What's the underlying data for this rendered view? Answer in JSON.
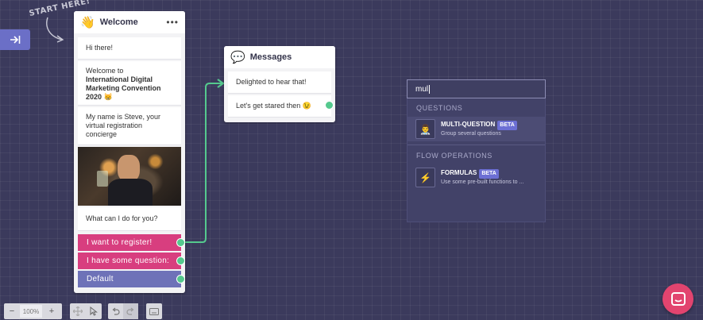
{
  "canvas": {
    "start_hint": "START HERE!"
  },
  "welcome_node": {
    "emoji": "👋",
    "title": "Welcome",
    "menu": "•••",
    "messages": [
      "Hi there!",
      "Welcome to",
      "International Digital Marketing Convention 2020 😸",
      "My name is Steve, your virtual registration concierge",
      "What can I do for you?"
    ],
    "options": [
      "I want to register!",
      "I have some question:",
      "Default"
    ]
  },
  "messages_node": {
    "emoji": "💬",
    "title": "Messages",
    "messages": [
      "Delighted to hear that!",
      "Let's get stared then 😉"
    ]
  },
  "search": {
    "value": "mul",
    "sections": [
      {
        "heading": "QUESTIONS",
        "results": [
          {
            "icon": "👨‍⚕️",
            "label": "MULTI-QUESTION",
            "badge": "BETA",
            "description": "Group several questions"
          }
        ]
      },
      {
        "heading": "FLOW OPERATIONS",
        "results": [
          {
            "icon": "⚡",
            "label": "FORMULAS",
            "badge": "BETA",
            "description": "Use some pre-built functions to ..."
          }
        ]
      }
    ]
  },
  "toolbar": {
    "zoom_out": "−",
    "zoom": "100%",
    "zoom_in": "+"
  },
  "colors": {
    "canvas": "#3b3a5c",
    "option_pink": "#d83e7f",
    "option_default": "#6e72b8",
    "port": "#55c98e",
    "launcher": "#e2446f",
    "accent": "#6b6fc7"
  }
}
